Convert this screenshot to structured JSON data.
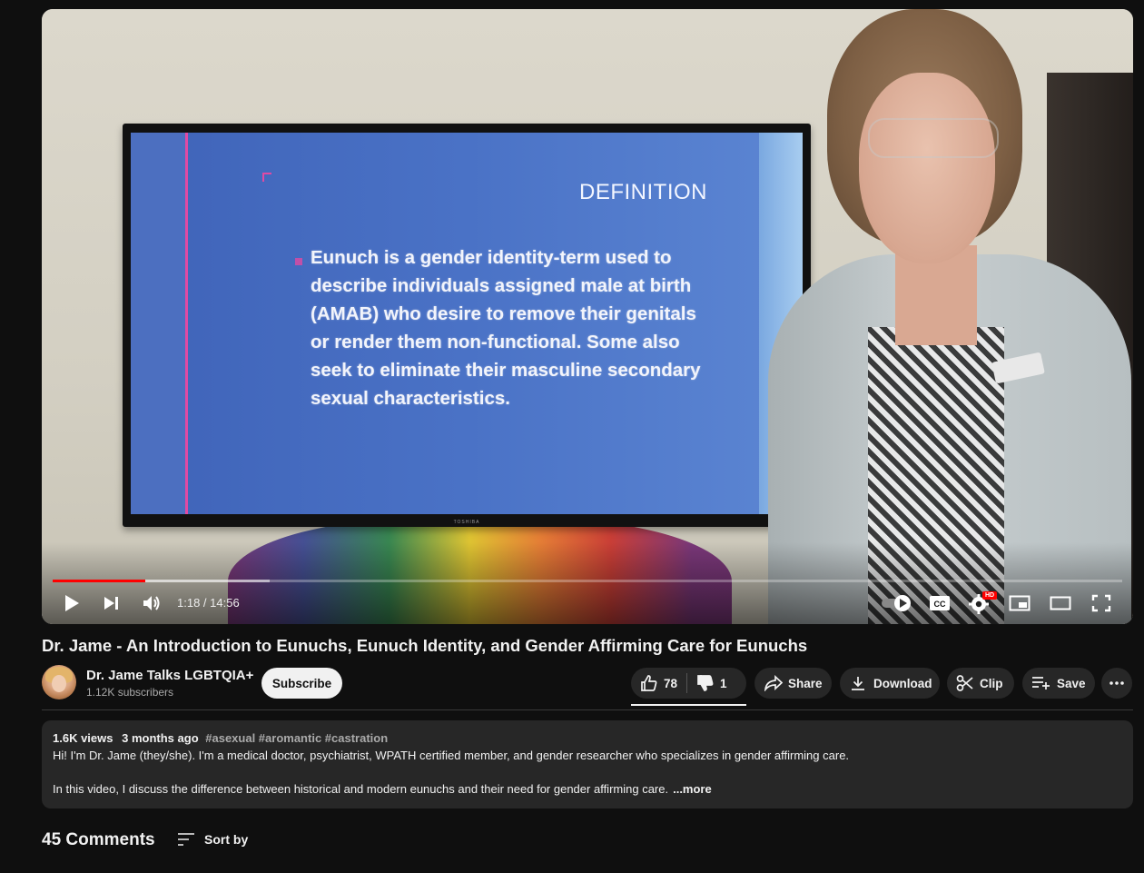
{
  "player": {
    "slide": {
      "title": "DEFINITION",
      "body": "Eunuch is a gender identity-term used to describe individuals assigned male at birth (AMAB) who desire to remove their genitals or render them non-functional. Some also seek to eliminate their masculine secondary sexual characteristics.",
      "tv_brand": "TOSHIBA"
    },
    "time": "1:18 / 14:56",
    "progress_played_fraction": 0.087,
    "progress_buffered_fraction": 0.203,
    "settings_badge": "HD",
    "icons": [
      "play-icon",
      "next-icon",
      "volume-icon",
      "autoplay-toggle-icon",
      "cc-icon",
      "gear-icon",
      "miniplayer-icon",
      "theater-icon",
      "fullscreen-icon"
    ],
    "accent": "#ff0000"
  },
  "video": {
    "title": "Dr. Jame - An Introduction to Eunuchs, Eunuch Identity, and Gender Affirming Care for Eunuchs"
  },
  "channel": {
    "name": "Dr. Jame Talks LGBTQIA+",
    "subscribers": "1.12K subscribers",
    "subscribe_label": "Subscribe"
  },
  "actions": {
    "likes": "78",
    "dislikes": "1",
    "share": "Share",
    "download": "Download",
    "clip": "Clip",
    "save": "Save"
  },
  "description": {
    "views": "1.6K views",
    "age": "3 months ago",
    "tags": "#asexual #aromantic #castration",
    "line1": "Hi! I'm Dr. Jame (they/she). I'm a medical doctor, psychiatrist, WPATH certified member, and gender researcher who specializes in gender affirming care.",
    "line2": "In this video, I discuss the difference between historical and modern eunuchs and their need for gender affirming care.",
    "more": "...more"
  },
  "comments": {
    "count": "45 Comments",
    "sort_label": "Sort by"
  }
}
